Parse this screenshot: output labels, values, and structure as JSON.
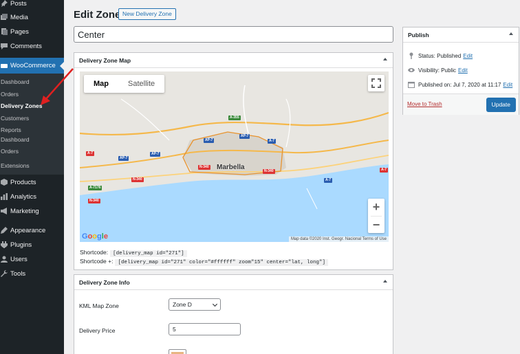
{
  "sidebar": {
    "items": [
      {
        "label": "Posts",
        "icon": "pin-icon"
      },
      {
        "label": "Media",
        "icon": "media-icon"
      },
      {
        "label": "Pages",
        "icon": "pages-icon"
      },
      {
        "label": "Comments",
        "icon": "comments-icon"
      },
      {
        "label": "WooCommerce",
        "icon": "woocommerce-icon"
      },
      {
        "label": "Products",
        "icon": "products-icon"
      },
      {
        "label": "Analytics",
        "icon": "analytics-icon"
      },
      {
        "label": "Marketing",
        "icon": "marketing-icon"
      },
      {
        "label": "Appearance",
        "icon": "appearance-icon"
      },
      {
        "label": "Plugins",
        "icon": "plugins-icon"
      },
      {
        "label": "Users",
        "icon": "users-icon"
      },
      {
        "label": "Tools",
        "icon": "tools-icon"
      }
    ],
    "woo_submenu": [
      "Dashboard",
      "Orders",
      "Delivery Zones",
      "Customers",
      "Reports",
      "Dashboard",
      "Orders",
      "Extensions"
    ]
  },
  "header": {
    "title": "Edit Zone",
    "add_new": "New Delivery Zone"
  },
  "post_title": "Center",
  "map_box": {
    "title": "Delivery Zone Map",
    "map_type_map": "Map",
    "map_type_satellite": "Satellite",
    "city": "Marbella",
    "road_badges": [
      "A-355",
      "AP-7",
      "AP-7",
      "A-7",
      "AP-7",
      "AP-7",
      "A-7",
      "N-340",
      "N-340",
      "A-7176",
      "N-340",
      "N-340",
      "A-7",
      "A-7"
    ],
    "google": "Google",
    "attribution": "Map data ©2020 Inst. Geogr. Nacional    Terms of Use",
    "zoom_in": "+",
    "zoom_out": "−",
    "shortcode_label": "Shortcode:",
    "shortcode_value": "[delivery_map id=\"271\"]",
    "shortcode_plus_label": "Shortcode +:",
    "shortcode_plus_value": "[delivery_map id=\"271\" color=\"#ffffff\" zoom\"15\" center=\"lat, long\"]"
  },
  "info_box": {
    "title": "Delivery Zone Info",
    "kml_label": "KML Map Zone",
    "kml_value": "Zone D",
    "price_label": "Delivery Price",
    "price_value": "5",
    "color_value": "#e8b582"
  },
  "publish": {
    "title": "Publish",
    "status_label": "Status: ",
    "status_value": "Published",
    "visibility_label": "Visibility: ",
    "visibility_value": "Public",
    "published_label": "Published on: ",
    "published_value": "Jul 7, 2020 at 11:17",
    "edit": "Edit",
    "trash": "Move to Trash",
    "update": "Update"
  },
  "colors": {
    "admin_bar": "#1d2327",
    "woo_active": "#2271b1",
    "annotation_arrow": "#e02020",
    "water": "#aadaff"
  }
}
